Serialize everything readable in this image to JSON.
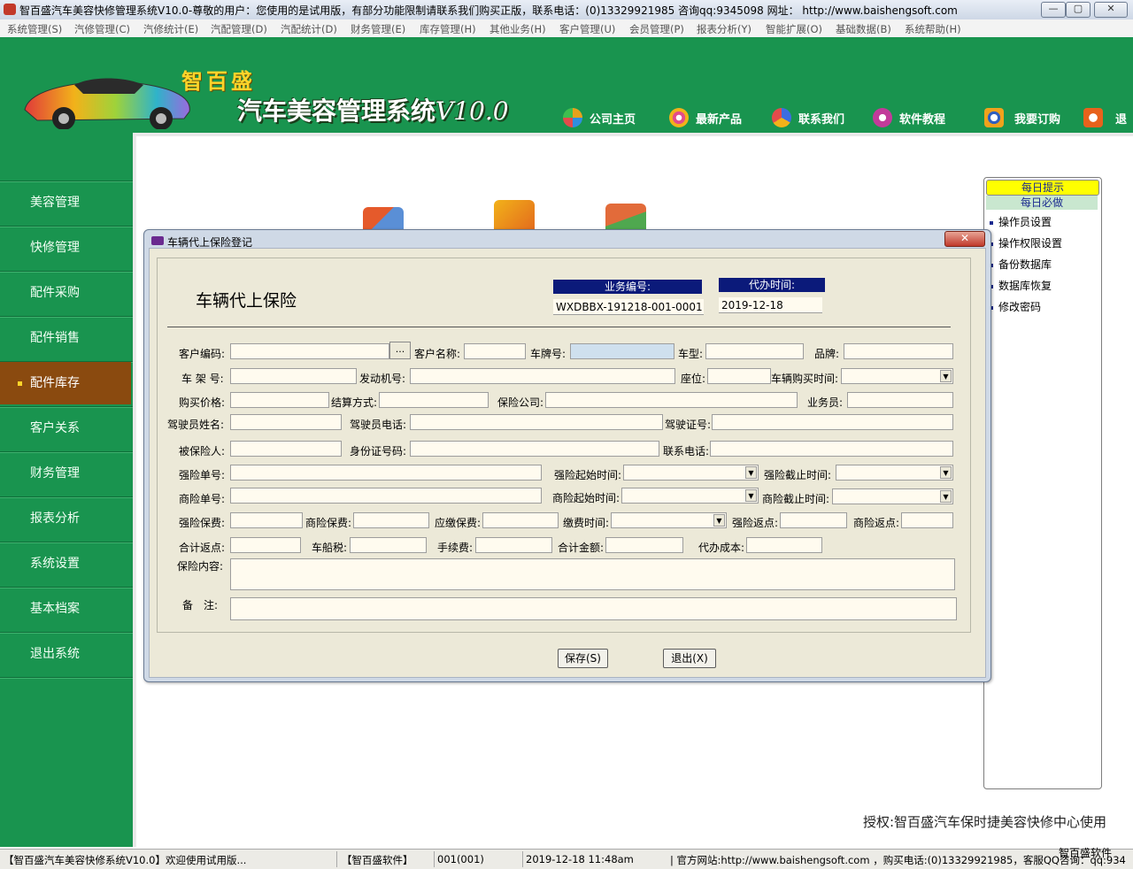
{
  "window": {
    "title": "智百盛汽车美容快修管理系统V10.0-尊敬的用户：您使用的是试用版，有部分功能限制请联系我们购买正版，联系电话：(0)13329921985  咨询qq:9345098    网址：  http://www.baishengsoft.com",
    "min": "—",
    "max": "▢",
    "close": "✕"
  },
  "menu": [
    "系统管理(S)",
    "汽修管理(C)",
    "汽修统计(E)",
    "汽配管理(D)",
    "汽配统计(D)",
    "财务管理(E)",
    "库存管理(H)",
    "其他业务(H)",
    "客户管理(U)",
    "会员管理(P)",
    "报表分析(Y)",
    "智能扩展(O)",
    "基础数据(B)",
    "系统帮助(H)"
  ],
  "header": {
    "brand_small": "智百盛",
    "brand_main": "汽车美容管理系统",
    "brand_version": "V10.0",
    "nav": [
      {
        "label": "公司主页",
        "icon": "pie-icon",
        "color": "#e8a11c"
      },
      {
        "label": "最新产品",
        "icon": "flower-icon",
        "color": "#e34b8a"
      },
      {
        "label": "联系我们",
        "icon": "contact-icon",
        "color": "#3d6de0"
      },
      {
        "label": "软件教程",
        "icon": "butterfly-icon",
        "color": "#c23b9a"
      },
      {
        "label": "我要订购",
        "icon": "order-icon",
        "color": "#f0a21c"
      },
      {
        "label": "退",
        "icon": "exit-icon",
        "color": "#e8621c"
      }
    ]
  },
  "sidebar": {
    "items": [
      "美容管理",
      "快修管理",
      "配件采购",
      "配件销售",
      "配件库存",
      "客户关系",
      "财务管理",
      "报表分析",
      "系统设置",
      "基本档案",
      "退出系统"
    ],
    "active": "配件库存"
  },
  "right_panel": {
    "title": "每日提示",
    "subtitle": "每日必做",
    "links": [
      "操作员设置",
      "操作权限设置",
      "备份数据库",
      "数据库恢复",
      "修改密码"
    ]
  },
  "license_text": "授权:智百盛汽车保时捷美容快修中心使用",
  "dialog": {
    "title": "车辆代上保险登记",
    "close": "✕",
    "heading": "车辆代上保险",
    "biz_no_label": "业务编号:",
    "biz_no_value": "WXDBBX-191218-001-0001",
    "time_label": "代办时间:",
    "time_value": "2019-12-18",
    "labels": {
      "customer_code": "客户编码:",
      "customer_name": "客户名称:",
      "plate": "车牌号:",
      "model": "车型:",
      "brand": "品牌:",
      "frame": "车 架 号:",
      "engine": "发动机号:",
      "seats": "座位:",
      "buy_time": "车辆购买时间:",
      "price": "购买价格:",
      "settle": "结算方式:",
      "insurer": "保险公司:",
      "salesman": "业务员:",
      "driver_name": "驾驶员姓名:",
      "driver_phone": "驾驶员电话:",
      "license_no": "驾驶证号:",
      "insured": "被保险人:",
      "id_no": "身份证号码:",
      "contact": "联系电话:",
      "ci_no": "强险单号:",
      "ci_start": "强险起始时间:",
      "ci_end": "强险截止时间:",
      "bi_no": "商险单号:",
      "bi_start": "商险起始时间:",
      "bi_end": "商险截止时间:",
      "ci_fee": "强险保费:",
      "bi_fee": "商险保费:",
      "due_fee": "应缴保费:",
      "pay_time": "缴费时间:",
      "ci_rebate": "强险返点:",
      "bi_rebate": "商险返点:",
      "total_rebate": "合计返点:",
      "vessel_tax": "车船税:",
      "handling": "手续费:",
      "total": "合计金额:",
      "cost": "代办成本:",
      "content": "保险内容:",
      "remark": "备　注:"
    },
    "dots": "...",
    "save": "保存(S)",
    "exit": "退出(X)"
  },
  "status": {
    "app": "【智百盛汽车美容快修系统V10.0】欢迎使用试用版...",
    "company": "【智百盛软件】",
    "user": "001(001)",
    "datetime": "2019-12-18 11:48am",
    "site": "| 官方网站:http://www.baishengsoft.com ，购买电话:(0)13329921985，客服QQ咨询：qq:934",
    "overlay": "智百盛软件"
  }
}
